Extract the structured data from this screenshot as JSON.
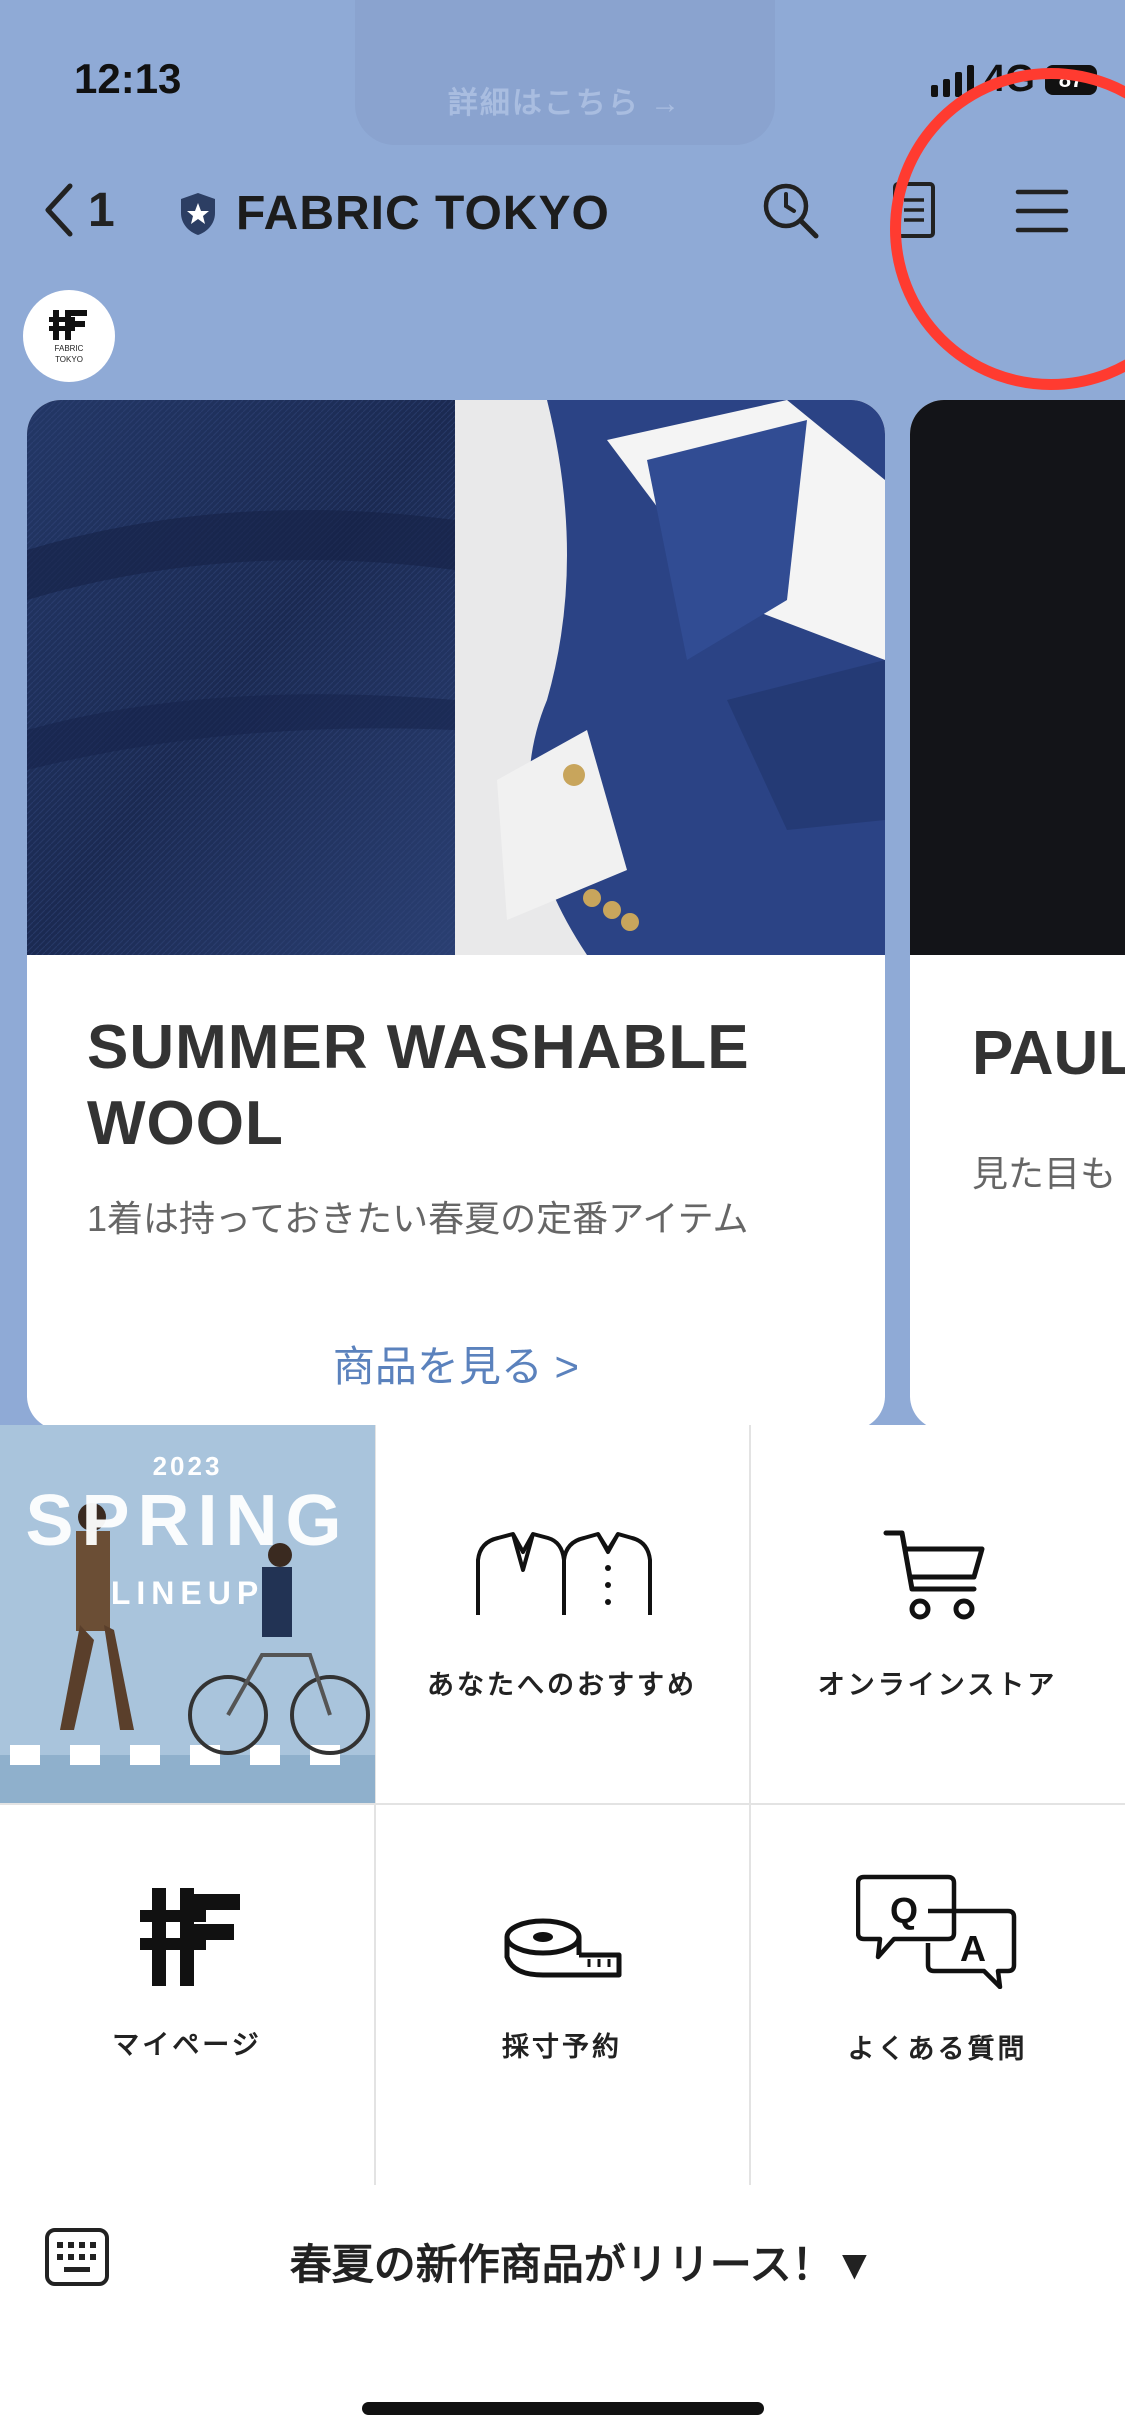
{
  "status_bar": {
    "time": "12:13",
    "network": "4G",
    "battery": "87"
  },
  "background_banner": {
    "text": "詳細はこちら →"
  },
  "header": {
    "back_count": "1",
    "account_name": "FABRIC TOKYO",
    "icons": [
      "chevron-left-icon",
      "shield-star-icon",
      "search-clock-icon",
      "notes-icon",
      "hamburger-menu-icon"
    ]
  },
  "avatar": {
    "line1": "FABRIC",
    "line2": "TOKYO"
  },
  "carousel": {
    "cards": [
      {
        "title": "SUMMER WASHABLE WOOL",
        "subtitle": "1着は持っておきたい春夏の定番アイテム",
        "link": "商品を見る >"
      },
      {
        "title": "PAUL",
        "subtitle": "見た目も"
      }
    ]
  },
  "rich_menu": {
    "banner": {
      "year": "2023",
      "title": "SPRING",
      "subtitle": "LINEUP"
    },
    "items": [
      {
        "label": "あなたへのおすすめ",
        "icon": "shirts-icon"
      },
      {
        "label": "オンラインストア",
        "icon": "cart-icon"
      },
      {
        "label": "マイページ",
        "icon": "fabric-tokyo-logo-icon"
      },
      {
        "label": "採寸予約",
        "icon": "measuring-tape-icon"
      },
      {
        "label": "よくある質問",
        "icon": "qa-bubbles-icon"
      }
    ]
  },
  "bottom_bar": {
    "menu_label": "春夏の新作商品がリリース！▼"
  },
  "colors": {
    "chat_bg": "#8faad6",
    "link": "#5b82bd",
    "highlight": "#ff3b30"
  }
}
